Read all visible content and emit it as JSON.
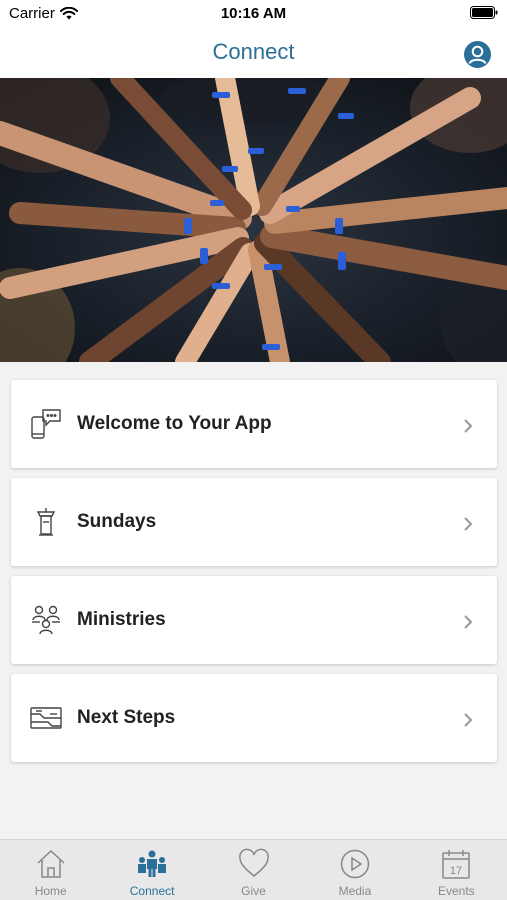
{
  "status": {
    "carrier": "Carrier",
    "time": "10:16 AM"
  },
  "header": {
    "title": "Connect"
  },
  "menu": [
    {
      "label": "Welcome to Your App",
      "icon": "phone-chat-icon"
    },
    {
      "label": "Sundays",
      "icon": "pulpit-icon"
    },
    {
      "label": "Ministries",
      "icon": "people-group-icon"
    },
    {
      "label": "Next Steps",
      "icon": "steps-icon"
    }
  ],
  "tabs": [
    {
      "label": "Home",
      "icon": "home-icon",
      "active": false
    },
    {
      "label": "Connect",
      "icon": "connect-icon",
      "active": true
    },
    {
      "label": "Give",
      "icon": "heart-icon",
      "active": false
    },
    {
      "label": "Media",
      "icon": "play-icon",
      "active": false
    },
    {
      "label": "Events",
      "icon": "calendar-icon",
      "active": false
    }
  ],
  "calendar_day": "17",
  "colors": {
    "accent": "#2a6f97",
    "inactive": "#888888"
  }
}
